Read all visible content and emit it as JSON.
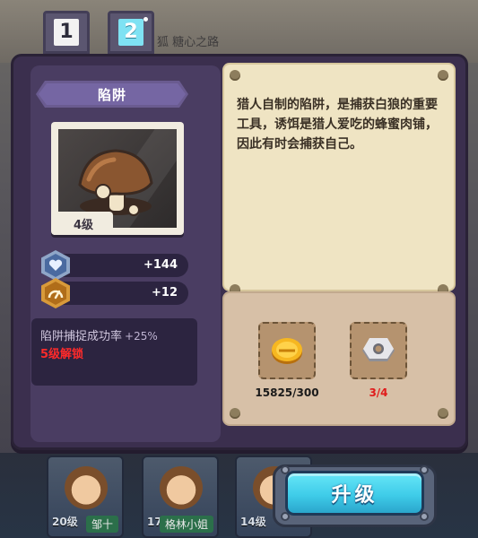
{
  "tabs": [
    {
      "label": "1",
      "active": false
    },
    {
      "label": "2",
      "active": true
    }
  ],
  "background": {
    "caption": "狐 糖心之路",
    "cards": [
      {
        "level": "20级",
        "name": "邹十"
      },
      {
        "level": "17级",
        "name": "格林小姐"
      },
      {
        "level": "14级",
        "name": ""
      }
    ]
  },
  "item": {
    "title": "陷阱",
    "level": "4级",
    "description": "猎人自制的陷阱，是捕获白狼的重要工具，诱饵是猎人爱吃的蜂蜜肉铺，因此有时会捕获自己。",
    "stats": [
      {
        "icon": "heart-shield-icon",
        "value": "+144"
      },
      {
        "icon": "speed-gauge-icon",
        "value": "+12"
      }
    ],
    "unlock": {
      "text": "陷阱捕捉成功率",
      "bonus": "+25%",
      "requirement": "5级解锁"
    }
  },
  "costs": [
    {
      "icon": "gold-coin-icon",
      "amount": "15825/300",
      "color": "#1a1a1a"
    },
    {
      "icon": "hex-nut-icon",
      "amount": "3/4",
      "color": "#e01b1b"
    }
  ],
  "upgrade_button": {
    "label": "升级"
  },
  "colors": {
    "dialog_bg": "#3b2f4e",
    "panel_bg": "#4a3d62",
    "parchment": "#efe4c3",
    "upgrade_cyan": "#3fcce9",
    "warning_red": "#e01b1b"
  }
}
